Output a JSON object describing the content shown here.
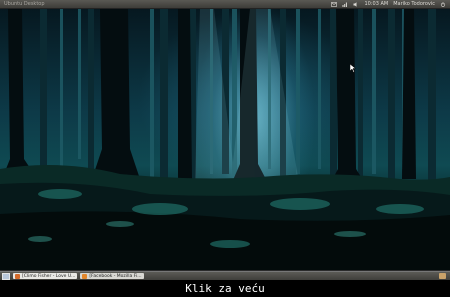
{
  "topbar": {
    "window_title": "Ubuntu Desktop",
    "clock": "10:03 AM",
    "user": "Mariko Todorovic"
  },
  "taskbar": {
    "tasks": [
      {
        "label": "[Climo Fisher - Love U..."
      },
      {
        "label": "[Facebook - Mozilla Fi..."
      }
    ]
  },
  "caption": "Klik za veću",
  "colors": {
    "panel": "#3d3c38",
    "caption_bg": "#000000",
    "caption_text": "#ffffff"
  }
}
